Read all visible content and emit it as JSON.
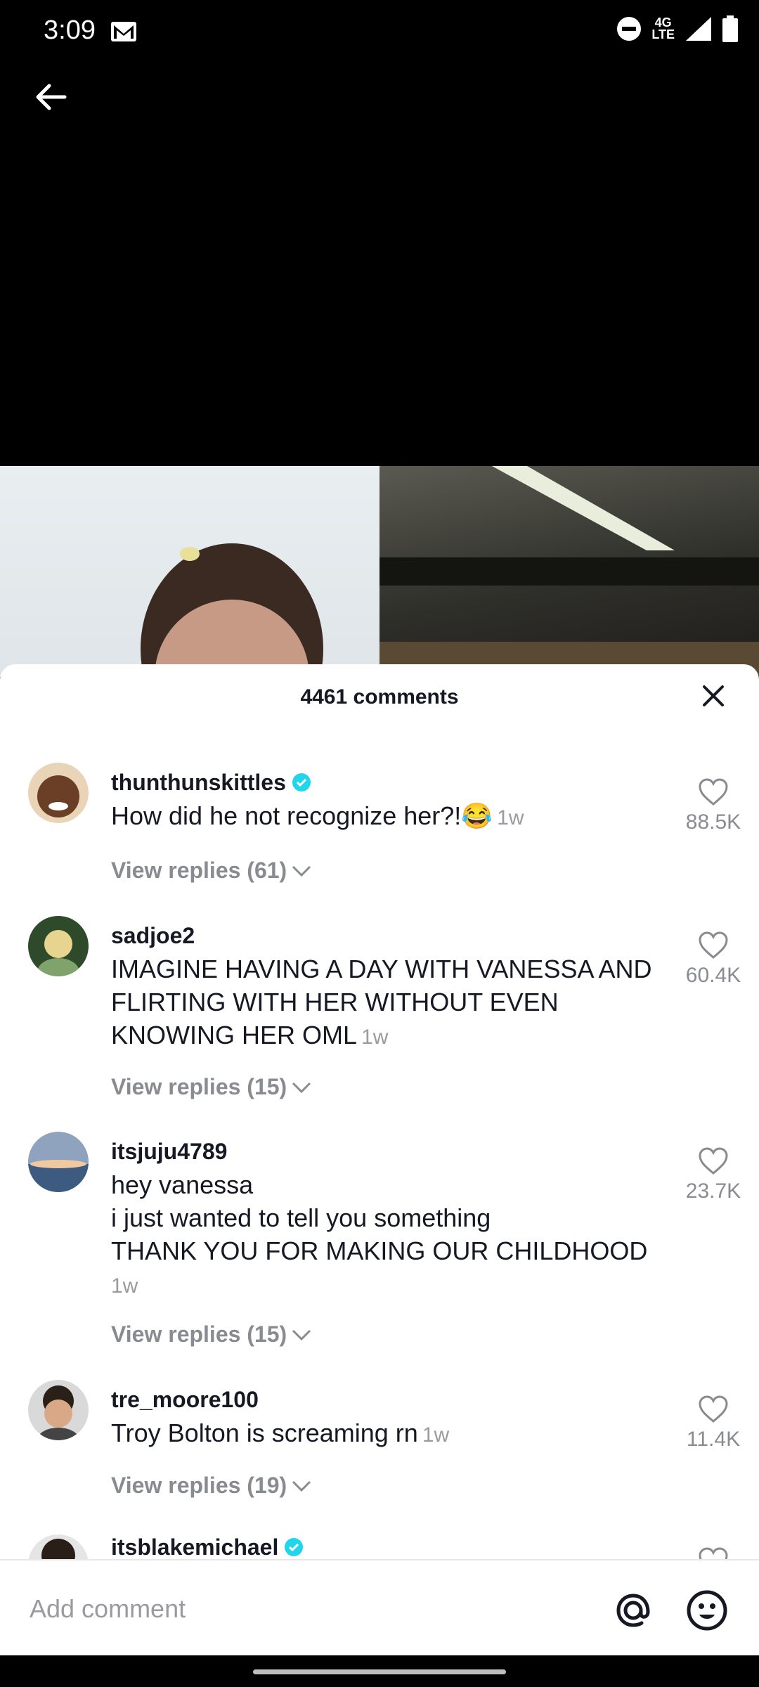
{
  "status": {
    "time": "3:09",
    "network": "4G\nLTE"
  },
  "sheet": {
    "title": "4461 comments"
  },
  "comments": [
    {
      "user": "thunthunskittles",
      "verified": true,
      "text": "How did he not recognize her?!😂",
      "time": "1w",
      "likes": "88.5K",
      "replies": "View replies (61)"
    },
    {
      "user": "sadjoe2",
      "verified": false,
      "text": "IMAGINE HAVING A DAY WITH VANESSA AND FLIRTING WITH HER WITHOUT EVEN KNOWING HER OML",
      "time": "1w",
      "likes": "60.4K",
      "replies": "View replies (15)"
    },
    {
      "user": "itsjuju4789",
      "verified": false,
      "text": "hey vanessa\ni just wanted to tell you something\nTHANK YOU FOR MAKING OUR CHILDHOOD",
      "time": "1w",
      "likes": "23.7K",
      "replies": "View replies (15)"
    },
    {
      "user": "tre_moore100",
      "verified": false,
      "text": "Troy Bolton is screaming rn",
      "time": "1w",
      "likes": "11.4K",
      "replies": "View replies (19)"
    },
    {
      "user": "itsblakemichael",
      "verified": true
    }
  ],
  "input": {
    "placeholder": "Add comment"
  },
  "colors": {
    "verified": "#20d5ec",
    "sheet_bg": "#ffffff",
    "text": "#161823",
    "muted": "#8a8b91"
  }
}
